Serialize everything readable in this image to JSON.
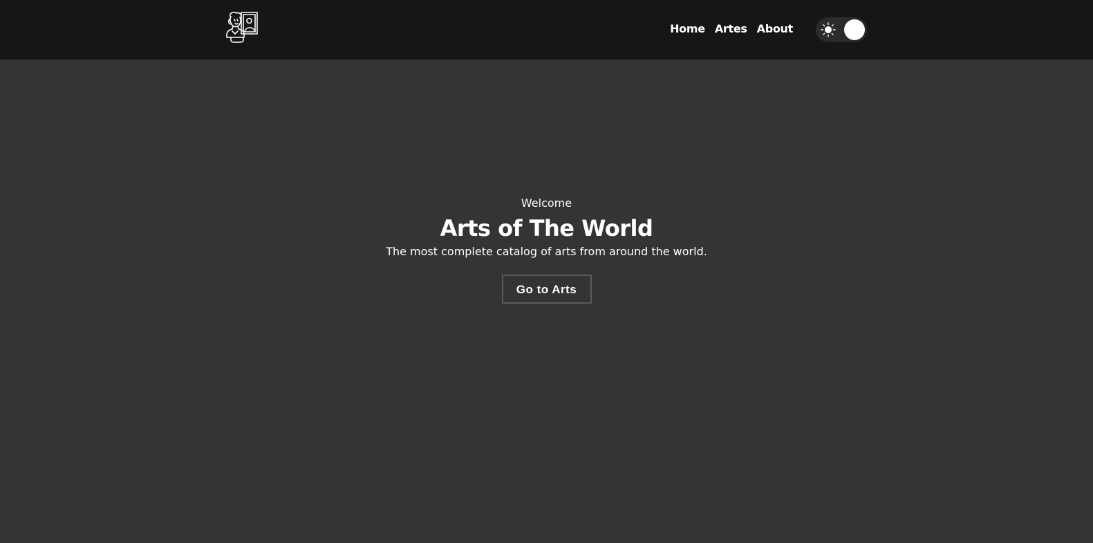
{
  "header": {
    "logo_icon": "bust-and-painting-icon",
    "nav": [
      {
        "label": "Home"
      },
      {
        "label": "Artes"
      },
      {
        "label": "About"
      }
    ],
    "theme_toggle": {
      "icon": "sun-icon",
      "state": "light-mode"
    }
  },
  "hero": {
    "welcome": "Welcome",
    "title": "Arts of The World",
    "subtitle": "The most complete catalog of arts from around the world.",
    "cta_label": "Go to Arts"
  },
  "colors": {
    "header_bg": "#161616",
    "page_bg": "#343434",
    "text": "#ffffff",
    "button_border": "#5a5a5a"
  }
}
